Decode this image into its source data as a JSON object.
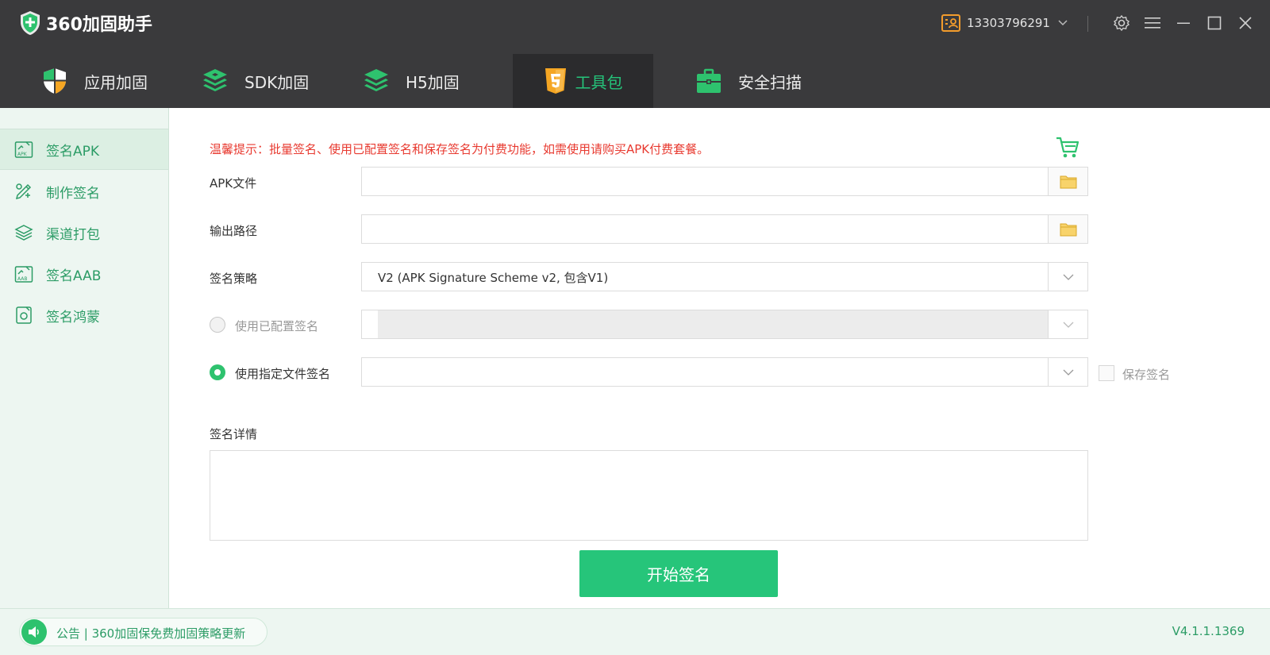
{
  "header": {
    "app_title": "360加固助手",
    "account_number": "13303796291"
  },
  "nav": {
    "tabs": [
      {
        "label": "应用加固",
        "icon": "shield-icon"
      },
      {
        "label": "SDK加固",
        "icon": "layers-icon"
      },
      {
        "label": "H5加固",
        "icon": "layers-icon"
      },
      {
        "label": "工具包",
        "icon": "html5-icon",
        "active": true
      },
      {
        "label": "安全扫描",
        "icon": "toolbox-icon"
      }
    ]
  },
  "sidebar": {
    "items": [
      {
        "label": "签名APK",
        "icon": "sign-apk-icon",
        "active": true
      },
      {
        "label": "制作签名",
        "icon": "make-signature-icon"
      },
      {
        "label": "渠道打包",
        "icon": "channel-pack-icon"
      },
      {
        "label": "签名AAB",
        "icon": "sign-aab-icon"
      },
      {
        "label": "签名鸿蒙",
        "icon": "sign-harmony-icon"
      }
    ]
  },
  "main": {
    "notice": "温馨提示：批量签名、使用已配置签名和保存签名为付费功能，如需使用请购买APK付费套餐。",
    "apk_file_label": "APK文件",
    "apk_file_value": "",
    "output_path_label": "输出路径",
    "output_path_value": "",
    "sign_strategy_label": "签名策略",
    "sign_strategy_value": "V2 (APK Signature Scheme v2, 包含V1)",
    "use_configured_label": "使用已配置签名",
    "use_file_label": "使用指定文件签名",
    "save_signature_label": "保存签名",
    "details_label": "签名详情",
    "start_button": "开始签名"
  },
  "footer": {
    "announcement": "公告 | 360加固保免费加固策略更新",
    "version": "V4.1.1.1369"
  },
  "colors": {
    "header_bg": "#3a3a3c",
    "accent_green": "#26c57a",
    "notice_red": "#e83a30",
    "sidebar_bg": "#edf6f1"
  }
}
